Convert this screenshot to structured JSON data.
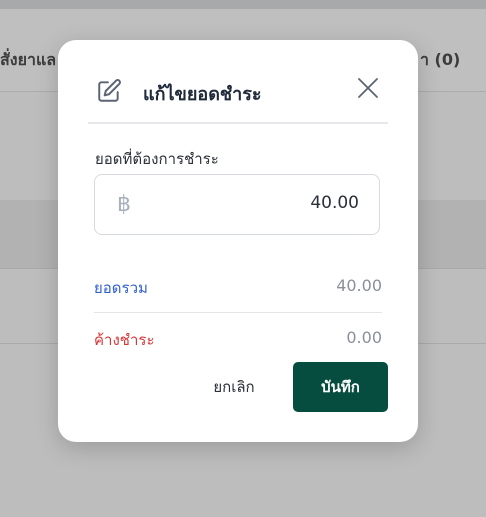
{
  "background": {
    "tab_left_label": "สั่งยาแล",
    "tab_right_label": "า (0)"
  },
  "dialog": {
    "title": "แก้ไขยอดชำระ",
    "edit_icon": "edit-icon",
    "close_icon": "close-icon",
    "amount_field": {
      "label": "ยอดที่ต้องการชำระ",
      "currency_symbol": "฿",
      "value": "40.00"
    },
    "summary": {
      "total_label": "ยอดรวม",
      "total_value": "40.00",
      "outstanding_label": "ค้างชำระ",
      "outstanding_value": "0.00"
    },
    "buttons": {
      "cancel_label": "ยกเลิก",
      "save_label": "บันทึก"
    }
  },
  "colors": {
    "primary": "#064d3f",
    "total_label": "#2f5ed1",
    "outstanding_label": "#d93636"
  }
}
